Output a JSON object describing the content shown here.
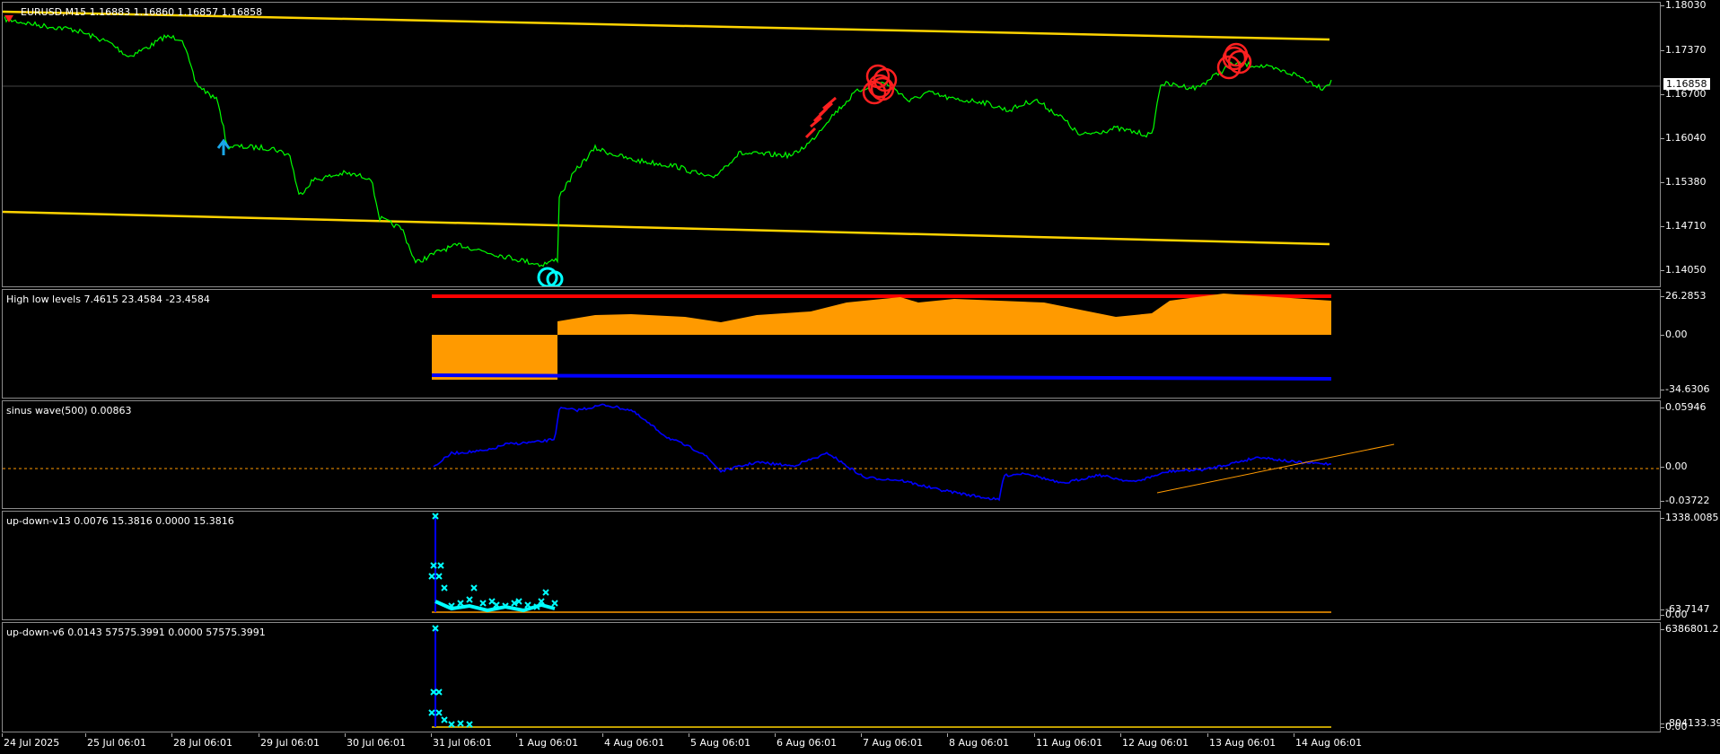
{
  "colors": {
    "background": "#000000",
    "price_line": "#00ff00",
    "channel": "#ffd400",
    "high_level": "#ff0000",
    "low_level": "#0000ff",
    "histogram": "#ff9a00",
    "sinus": "#0000ff",
    "marker": "#00ffff",
    "signal_red": "#ff2020",
    "arrow_up": "#1aa7e8",
    "trend": "#ff9a00"
  },
  "main": {
    "title": "EURUSD,M15  1.16883 1.16860 1.16857 1.16858",
    "current_price": "1.16858",
    "ticks": [
      "1.18030",
      "1.17370",
      "1.16700",
      "1.16040",
      "1.15380",
      "1.14710",
      "1.14050"
    ]
  },
  "high_low": {
    "label": "High low levels 7.4615 23.4584 -23.4584",
    "ticks": [
      "26.2853",
      "0.00",
      "-34.6306"
    ]
  },
  "sinus": {
    "label": "sinus wave(500) 0.00863",
    "ticks": [
      "0.05946",
      "0.00",
      "-0.03722"
    ]
  },
  "updown13": {
    "label": "up-down-v13 0.0076 15.3816 0.0000 15.3816",
    "ticks": [
      "1338.0085",
      "-63.7147",
      "0.00"
    ]
  },
  "updown6": {
    "label": "up-down-v6 0.0143 57575.3991 0.0000 57575.3991",
    "ticks": [
      "6386801.2",
      "-804133.39",
      "0.00"
    ]
  },
  "dates": [
    "24 Jul 2025",
    "25 Jul 06:01",
    "28 Jul 06:01",
    "29 Jul 06:01",
    "30 Jul 06:01",
    "31 Jul 06:01",
    "1 Aug 06:01",
    "4 Aug 06:01",
    "5 Aug 06:01",
    "6 Aug 06:01",
    "7 Aug 06:01",
    "8 Aug 06:01",
    "11 Aug 06:01",
    "12 Aug 06:01",
    "13 Aug 06:01",
    "14 Aug 06:01"
  ]
}
